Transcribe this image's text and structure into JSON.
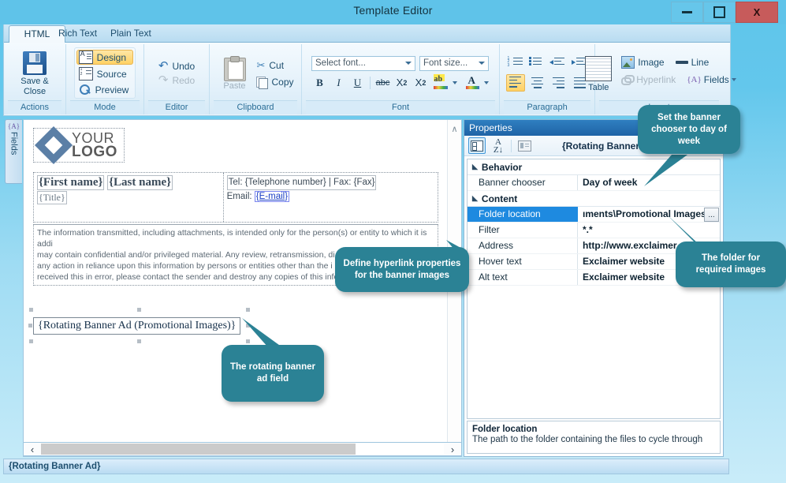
{
  "window": {
    "title": "Template Editor",
    "minimize_label": "minimize",
    "maximize_label": "maximize",
    "close_label": "X"
  },
  "ribbon": {
    "tabs": [
      {
        "label": "HTML",
        "active": true
      },
      {
        "label": "Rich Text",
        "active": false
      },
      {
        "label": "Plain Text",
        "active": false
      }
    ],
    "groups": {
      "actions": {
        "label": "Actions",
        "save_close": "Save &\nClose",
        "save_close_line1": "Save &",
        "save_close_line2": "Close"
      },
      "mode": {
        "label": "Mode",
        "items": [
          {
            "label": "Design",
            "selected": true
          },
          {
            "label": "Source",
            "selected": false
          },
          {
            "label": "Preview",
            "selected": false
          }
        ]
      },
      "editor": {
        "label": "Editor",
        "undo": "Undo",
        "redo": "Redo"
      },
      "clipboard": {
        "label": "Clipboard",
        "paste": "Paste",
        "cut": "Cut",
        "copy": "Copy"
      },
      "font": {
        "label": "Font",
        "font_select_value": "Select font...",
        "font_size_value": "Font size...",
        "bold": "B",
        "italic": "I",
        "underline": "U",
        "strikethrough": "abc",
        "subscript": "X2",
        "superscript": "X2",
        "highlight": "ab",
        "font_color": "A"
      },
      "paragraph": {
        "label": "Paragraph",
        "numbered_list": "numbered-list",
        "bulleted_list": "bulleted-list",
        "decrease_indent": "decrease-indent",
        "increase_indent": "increase-indent",
        "align_left": "align-left",
        "align_center": "align-center",
        "align_right": "align-right",
        "align_justify": "align-justify"
      },
      "insert": {
        "label": "Insert",
        "table": "Table",
        "image": "Image",
        "line": "Line",
        "hyperlink": "Hyperlink",
        "fields": "Fields"
      }
    }
  },
  "sidebar": {
    "fields_tab_label": "Fields",
    "fields_tab_icon": "{A}"
  },
  "editor_document": {
    "logo_line1": "YOUR",
    "logo_line2": "LOGO",
    "first_name": "{First name}",
    "last_name": "{Last name}",
    "title_field": "{Title}",
    "telephone_line": "Tel: {Telephone number} | Fax: {Fax}",
    "email_prefix": "Email: ",
    "email_field": "{E-mail}",
    "disclaimer_line1": "The information transmitted, including attachments, is intended only for the person(s) or entity to which it is addi",
    "disclaimer_line2": "may contain confidential and/or privileged material.  Any review, retransmission, di",
    "disclaimer_line3": "any action in reliance upon this information by persons or entities other than the i",
    "disclaimer_line4": "received this in error, please contact the sender and destroy any copies of this info",
    "banner_field": "{Rotating Banner Ad (Promotional Images)}"
  },
  "scrollbars": {
    "up_arrow": "∧",
    "down_arrow": "∨",
    "left_arrow": "‹",
    "right_arrow": "›"
  },
  "statusbar": {
    "text": "{Rotating Banner Ad}"
  },
  "properties": {
    "panel_title": "Properties",
    "toolbar": {
      "categorized_icon": "categorized-view-icon",
      "alphabetical_icon": "alphabetical-sort-icon",
      "pages_icon": "property-pages-icon",
      "selected_object": "{Rotating Banner Ad}"
    },
    "rows": [
      {
        "type": "category",
        "name": "Behavior"
      },
      {
        "type": "property",
        "name": "Banner chooser",
        "value": "Day of week",
        "selected": false
      },
      {
        "type": "category",
        "name": "Content"
      },
      {
        "type": "property",
        "name": "Folder location",
        "value": "ıments\\Promotional Images",
        "selected": true,
        "has_browse": true,
        "browse_label": "..."
      },
      {
        "type": "property",
        "name": "Filter",
        "value": "*.*",
        "selected": false
      },
      {
        "type": "property",
        "name": "Address",
        "value": "http://www.exclaimer.co.u",
        "selected": false
      },
      {
        "type": "property",
        "name": "Hover text",
        "value": "Exclaimer website",
        "selected": false
      },
      {
        "type": "property",
        "name": "Alt text",
        "value": "Exclaimer website",
        "selected": false
      }
    ],
    "help": {
      "title": "Folder location",
      "description": "The path to the folder containing the files to cycle through"
    }
  },
  "callouts": [
    {
      "id": "banner-chooser-callout",
      "text": "Set the banner chooser to day of week"
    },
    {
      "id": "folder-callout",
      "text": "The folder for required images"
    },
    {
      "id": "hyperlink-callout",
      "text": "Define hyperlink properties for the banner images"
    },
    {
      "id": "rotating-field-callout",
      "text": "The rotating banner ad field"
    }
  ],
  "colors": {
    "titlebar": "#5fc3e9",
    "callout": "#2b8295",
    "selection": "#1e8ae0",
    "props_header": "#2f7fc0",
    "close_button": "#c75b5b"
  }
}
